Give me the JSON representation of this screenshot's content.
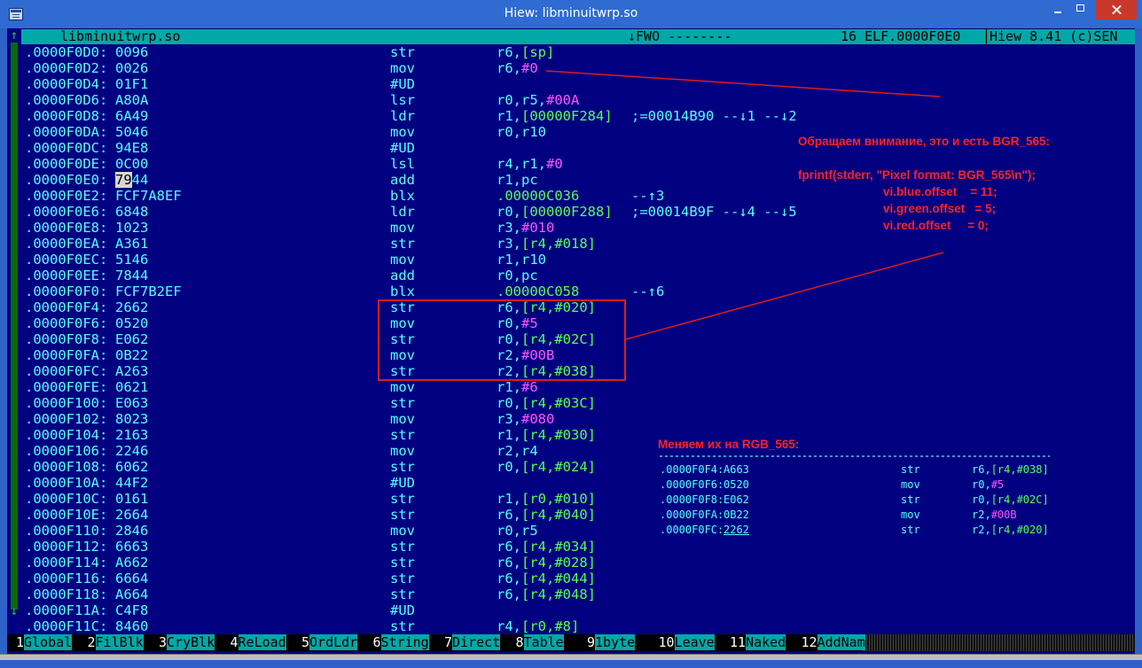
{
  "window": {
    "title": "Hiew: libminuitwrp.so"
  },
  "status": {
    "file": "libminuitwrp.so",
    "mode": "↓FWO --------",
    "info": "16 ELF.0000F0E0",
    "version": "Hiew 8.41 (c)SEN"
  },
  "rows": [
    {
      "addr": ".0000F0D0:",
      "code": "0096",
      "mn": "str",
      "op": "r6,",
      "g": "[sp]"
    },
    {
      "addr": ".0000F0D2:",
      "code": "0026",
      "mn": "mov",
      "op": "r6,",
      "m": "#0"
    },
    {
      "addr": ".0000F0D4:",
      "code": "01F1",
      "mn": "#UD"
    },
    {
      "addr": ".0000F0D6:",
      "code": "A80A",
      "mn": "lsr",
      "op": "r0,r5,",
      "m": "#00A"
    },
    {
      "addr": ".0000F0D8:",
      "code": "6A49",
      "mn": "ldr",
      "op": "r1,",
      "g": "[00000F284]",
      "cm": ";=00014B90 --↓1 --↓2"
    },
    {
      "addr": ".0000F0DA:",
      "code": "5046",
      "mn": "mov",
      "op": "r0,r10"
    },
    {
      "addr": ".0000F0DC:",
      "code": "94E8",
      "mn": "#UD"
    },
    {
      "addr": ".0000F0DE:",
      "code": "0C00",
      "mn": "lsl",
      "op": "r4,r1,",
      "m": "#0"
    },
    {
      "addr": ".0000F0E0:",
      "hi": "79",
      "code": "44",
      "mn": "add",
      "op": "r1,pc"
    },
    {
      "addr": ".0000F0E2:",
      "code": "FCF7A8EF",
      "mn": "blx",
      "g": ".00000C036",
      "cm": "--↑3"
    },
    {
      "addr": ".0000F0E6:",
      "code": "6848",
      "mn": "ldr",
      "op": "r0,",
      "g": "[00000F288]",
      "cm": ";=00014B9F --↓4 --↓5"
    },
    {
      "addr": ".0000F0E8:",
      "code": "1023",
      "mn": "mov",
      "op": "r3,",
      "m": "#010"
    },
    {
      "addr": ".0000F0EA:",
      "code": "A361",
      "mn": "str",
      "op": "r3,",
      "g": "[r4,#018]"
    },
    {
      "addr": ".0000F0EC:",
      "code": "5146",
      "mn": "mov",
      "op": "r1,r10"
    },
    {
      "addr": ".0000F0EE:",
      "code": "7844",
      "mn": "add",
      "op": "r0,pc"
    },
    {
      "addr": ".0000F0F0:",
      "code": "FCF7B2EF",
      "mn": "blx",
      "g": ".00000C058",
      "cm": "--↑6"
    },
    {
      "addr": ".0000F0F4:",
      "code": "2662",
      "mn": "str",
      "op": "r6,",
      "g": "[r4,#020]"
    },
    {
      "addr": ".0000F0F6:",
      "code": "0520",
      "mn": "mov",
      "op": "r0,",
      "m": "#5"
    },
    {
      "addr": ".0000F0F8:",
      "code": "E062",
      "mn": "str",
      "op": "r0,",
      "g": "[r4,#02C]"
    },
    {
      "addr": ".0000F0FA:",
      "code": "0B22",
      "mn": "mov",
      "op": "r2,",
      "m": "#00B"
    },
    {
      "addr": ".0000F0FC:",
      "code": "A263",
      "mn": "str",
      "op": "r2,",
      "g": "[r4,#038]"
    },
    {
      "addr": ".0000F0FE:",
      "code": "0621",
      "mn": "mov",
      "op": "r1,",
      "m": "#6"
    },
    {
      "addr": ".0000F100:",
      "code": "E063",
      "mn": "str",
      "op": "r0,",
      "g": "[r4,#03C]"
    },
    {
      "addr": ".0000F102:",
      "code": "8023",
      "mn": "mov",
      "op": "r3,",
      "m": "#080"
    },
    {
      "addr": ".0000F104:",
      "code": "2163",
      "mn": "str",
      "op": "r1,",
      "g": "[r4,#030]"
    },
    {
      "addr": ".0000F106:",
      "code": "2246",
      "mn": "mov",
      "op": "r2,r4"
    },
    {
      "addr": ".0000F108:",
      "code": "6062",
      "mn": "str",
      "op": "r0,",
      "g": "[r4,#024]"
    },
    {
      "addr": ".0000F10A:",
      "code": "44F2",
      "mn": "#UD"
    },
    {
      "addr": ".0000F10C:",
      "code": "0161",
      "mn": "str",
      "op": "r1,",
      "g": "[r0,#010]"
    },
    {
      "addr": ".0000F10E:",
      "code": "2664",
      "mn": "str",
      "op": "r6,",
      "g": "[r4,#040]"
    },
    {
      "addr": ".0000F110:",
      "code": "2846",
      "mn": "mov",
      "op": "r0,r5"
    },
    {
      "addr": ".0000F112:",
      "code": "6663",
      "mn": "str",
      "op": "r6,",
      "g": "[r4,#034]"
    },
    {
      "addr": ".0000F114:",
      "code": "A662",
      "mn": "str",
      "op": "r6,",
      "g": "[r4,#028]"
    },
    {
      "addr": ".0000F116:",
      "code": "6664",
      "mn": "str",
      "op": "r6,",
      "g": "[r4,#044]"
    },
    {
      "addr": ".0000F118:",
      "code": "A664",
      "mn": "str",
      "op": "r6,",
      "g": "[r4,#048]"
    },
    {
      "addr": ".0000F11A:",
      "code": "C4F8",
      "mn": "#UD"
    },
    {
      "addr": ".0000F11C:",
      "code": "8460",
      "mn": "str",
      "op": "r4,",
      "g": "[r0,#8]"
    }
  ],
  "annotation1": {
    "heading": "Обращаем внимание, это и есть BGR_565:",
    "code": "fprintf(stderr, \"Pixel format: BGR_565\\n\");",
    "lines": [
      "vi.blue.offset    = 11;",
      "vi.green.offset   = 5;",
      "vi.red.offset     = 0;"
    ]
  },
  "annotation2": {
    "heading": "Меняем их на RGB_565:"
  },
  "patched": [
    {
      "addr": ".0000F0F4:",
      "code": "A663",
      "mn": "str",
      "op": "r6,",
      "g": "[r4,#038]"
    },
    {
      "addr": ".0000F0F6:",
      "code": "0520",
      "mn": "mov",
      "op": "r0,",
      "m": "#5"
    },
    {
      "addr": ".0000F0F8:",
      "code": "E062",
      "mn": "str",
      "op": "r0,",
      "g": "[r4,#02C]"
    },
    {
      "addr": ".0000F0FA:",
      "code": "0B22",
      "mn": "mov",
      "op": "r2,",
      "m": "#00B"
    },
    {
      "addr": ".0000F0FC:",
      "code": "2262",
      "mn": "str",
      "op": "r2,",
      "g": "[r4,#020]"
    }
  ],
  "fkeys": [
    {
      "n": "1",
      "l": "Global"
    },
    {
      "n": "2",
      "l": "FilBlk"
    },
    {
      "n": "3",
      "l": "CryBlk"
    },
    {
      "n": "4",
      "l": "ReLoad"
    },
    {
      "n": "5",
      "l": "OrdLdr"
    },
    {
      "n": "6",
      "l": "String"
    },
    {
      "n": "7",
      "l": "Direct"
    },
    {
      "n": "8",
      "l": "Table"
    },
    {
      "n": "9",
      "l": "1byte"
    },
    {
      "n": "10",
      "l": "Leave"
    },
    {
      "n": "11",
      "l": "Naked"
    },
    {
      "n": "12",
      "l": "AddNam"
    }
  ]
}
